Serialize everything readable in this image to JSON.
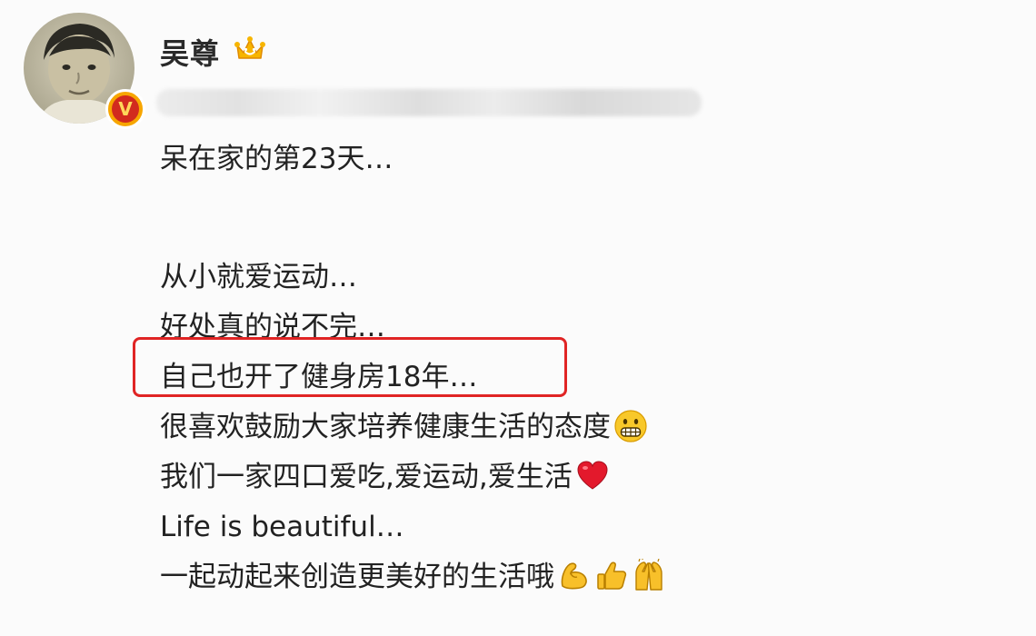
{
  "post": {
    "user_name": "吴尊",
    "lines": [
      "呆在家的第23天…",
      "从小就爱运动…",
      "好处真的说不完…",
      "自己也开了健身房18年…",
      "很喜欢鼓励大家培养健康生活的态度",
      "我们一家四口爱吃,爱运动,爱生活",
      "Life is beautiful…",
      "一起动起来创造更美好的生活哦"
    ],
    "icons": {
      "badge": "crown-icon",
      "verified": "verified-v-icon",
      "grimace": "grimacing-face-icon",
      "heart": "red-heart-icon",
      "muscle": "flexed-biceps-icon",
      "thumbs": "thumbs-up-icon",
      "hands": "raised-hands-icon"
    },
    "verified_letter": "V"
  },
  "colors": {
    "highlight_border": "#e02424",
    "verified_badge": "#f7a600",
    "text": "#222222"
  }
}
